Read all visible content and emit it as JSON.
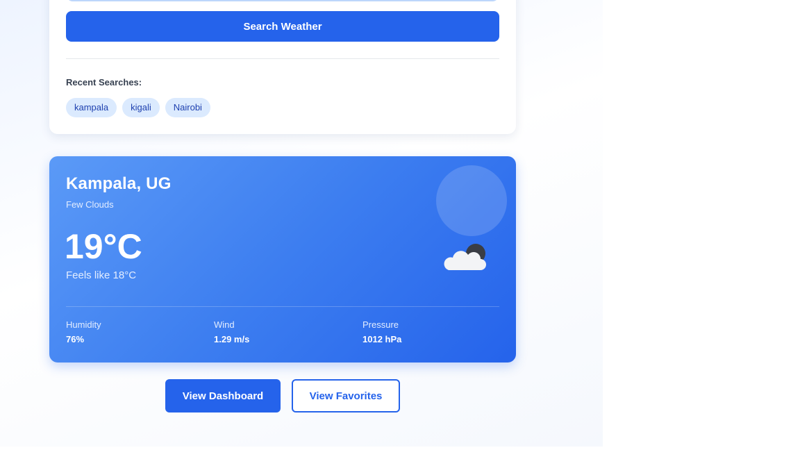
{
  "search": {
    "button_label": "Search Weather",
    "recent_label": "Recent Searches:",
    "recent": [
      "kampala",
      "kigali",
      "Nairobi"
    ]
  },
  "weather": {
    "location": "Kampala, UG",
    "condition": "Few Clouds",
    "temperature": "19°C",
    "feels_like": "Feels like 18°C",
    "icon": "cloud-moon-icon",
    "stats": [
      {
        "label": "Humidity",
        "value": "76%"
      },
      {
        "label": "Wind",
        "value": "1.29 m/s"
      },
      {
        "label": "Pressure",
        "value": "1012 hPa"
      }
    ]
  },
  "actions": {
    "dashboard_label": "View Dashboard",
    "favorites_label": "View Favorites"
  },
  "colors": {
    "accent": "#2563eb",
    "chip_bg": "#dbeafe",
    "chip_text": "#1e40af"
  }
}
